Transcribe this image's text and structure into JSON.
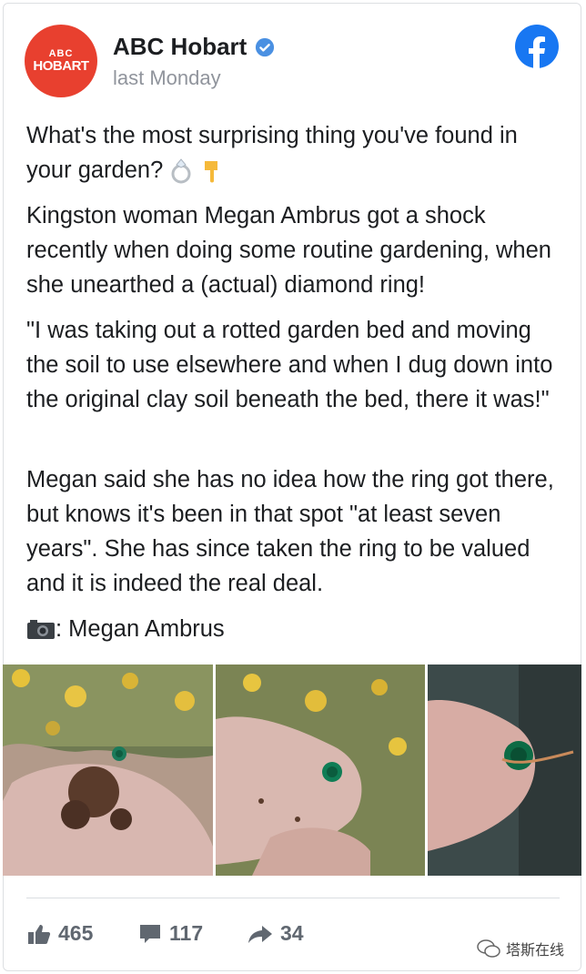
{
  "page": {
    "name": "ABC Hobart",
    "timestamp": "last Monday",
    "avatar_mark": "ABC",
    "avatar_text": "HOBART"
  },
  "post": {
    "para1": "What's the most surprising thing you've found in your garden?",
    "para2": "Kingston woman Megan Ambrus got a shock recently when doing some routine gardening, when she unearthed a (actual) diamond ring!",
    "para3": "\"I was taking out a rotted garden bed and moving the soil to use elsewhere and when I dug down into the original clay soil beneath the bed, there it was!\"",
    "para4": "Megan said she has no idea how the ring got there, but knows it's been in that spot \"at least seven years\". She has since taken the ring to be valued and it is indeed the real deal.",
    "credit": ": Megan Ambrus"
  },
  "stats": {
    "likes": "465",
    "comments": "117",
    "shares": "34"
  },
  "watermark": "塔斯在线",
  "colors": {
    "brand_red": "#e8402f",
    "facebook_blue": "#1877f2",
    "meta_grey": "#90949c",
    "stat_grey": "#606770"
  },
  "icons": [
    "verified-badge-icon",
    "facebook-logo-icon",
    "ring-emoji-icon",
    "pointing-down-emoji-icon",
    "camera-emoji-icon",
    "like-icon",
    "comment-icon",
    "share-icon",
    "wechat-icon"
  ]
}
